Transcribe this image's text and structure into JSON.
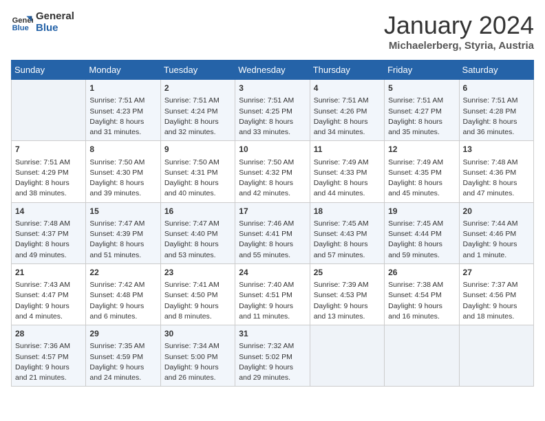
{
  "logo": {
    "line1": "General",
    "line2": "Blue"
  },
  "title": "January 2024",
  "location": "Michaelerberg, Styria, Austria",
  "weekdays": [
    "Sunday",
    "Monday",
    "Tuesday",
    "Wednesday",
    "Thursday",
    "Friday",
    "Saturday"
  ],
  "weeks": [
    [
      {
        "day": "",
        "sunrise": "",
        "sunset": "",
        "daylight": ""
      },
      {
        "day": "1",
        "sunrise": "Sunrise: 7:51 AM",
        "sunset": "Sunset: 4:23 PM",
        "daylight": "Daylight: 8 hours and 31 minutes."
      },
      {
        "day": "2",
        "sunrise": "Sunrise: 7:51 AM",
        "sunset": "Sunset: 4:24 PM",
        "daylight": "Daylight: 8 hours and 32 minutes."
      },
      {
        "day": "3",
        "sunrise": "Sunrise: 7:51 AM",
        "sunset": "Sunset: 4:25 PM",
        "daylight": "Daylight: 8 hours and 33 minutes."
      },
      {
        "day": "4",
        "sunrise": "Sunrise: 7:51 AM",
        "sunset": "Sunset: 4:26 PM",
        "daylight": "Daylight: 8 hours and 34 minutes."
      },
      {
        "day": "5",
        "sunrise": "Sunrise: 7:51 AM",
        "sunset": "Sunset: 4:27 PM",
        "daylight": "Daylight: 8 hours and 35 minutes."
      },
      {
        "day": "6",
        "sunrise": "Sunrise: 7:51 AM",
        "sunset": "Sunset: 4:28 PM",
        "daylight": "Daylight: 8 hours and 36 minutes."
      }
    ],
    [
      {
        "day": "7",
        "sunrise": "Sunrise: 7:51 AM",
        "sunset": "Sunset: 4:29 PM",
        "daylight": "Daylight: 8 hours and 38 minutes."
      },
      {
        "day": "8",
        "sunrise": "Sunrise: 7:50 AM",
        "sunset": "Sunset: 4:30 PM",
        "daylight": "Daylight: 8 hours and 39 minutes."
      },
      {
        "day": "9",
        "sunrise": "Sunrise: 7:50 AM",
        "sunset": "Sunset: 4:31 PM",
        "daylight": "Daylight: 8 hours and 40 minutes."
      },
      {
        "day": "10",
        "sunrise": "Sunrise: 7:50 AM",
        "sunset": "Sunset: 4:32 PM",
        "daylight": "Daylight: 8 hours and 42 minutes."
      },
      {
        "day": "11",
        "sunrise": "Sunrise: 7:49 AM",
        "sunset": "Sunset: 4:33 PM",
        "daylight": "Daylight: 8 hours and 44 minutes."
      },
      {
        "day": "12",
        "sunrise": "Sunrise: 7:49 AM",
        "sunset": "Sunset: 4:35 PM",
        "daylight": "Daylight: 8 hours and 45 minutes."
      },
      {
        "day": "13",
        "sunrise": "Sunrise: 7:48 AM",
        "sunset": "Sunset: 4:36 PM",
        "daylight": "Daylight: 8 hours and 47 minutes."
      }
    ],
    [
      {
        "day": "14",
        "sunrise": "Sunrise: 7:48 AM",
        "sunset": "Sunset: 4:37 PM",
        "daylight": "Daylight: 8 hours and 49 minutes."
      },
      {
        "day": "15",
        "sunrise": "Sunrise: 7:47 AM",
        "sunset": "Sunset: 4:39 PM",
        "daylight": "Daylight: 8 hours and 51 minutes."
      },
      {
        "day": "16",
        "sunrise": "Sunrise: 7:47 AM",
        "sunset": "Sunset: 4:40 PM",
        "daylight": "Daylight: 8 hours and 53 minutes."
      },
      {
        "day": "17",
        "sunrise": "Sunrise: 7:46 AM",
        "sunset": "Sunset: 4:41 PM",
        "daylight": "Daylight: 8 hours and 55 minutes."
      },
      {
        "day": "18",
        "sunrise": "Sunrise: 7:45 AM",
        "sunset": "Sunset: 4:43 PM",
        "daylight": "Daylight: 8 hours and 57 minutes."
      },
      {
        "day": "19",
        "sunrise": "Sunrise: 7:45 AM",
        "sunset": "Sunset: 4:44 PM",
        "daylight": "Daylight: 8 hours and 59 minutes."
      },
      {
        "day": "20",
        "sunrise": "Sunrise: 7:44 AM",
        "sunset": "Sunset: 4:46 PM",
        "daylight": "Daylight: 9 hours and 1 minute."
      }
    ],
    [
      {
        "day": "21",
        "sunrise": "Sunrise: 7:43 AM",
        "sunset": "Sunset: 4:47 PM",
        "daylight": "Daylight: 9 hours and 4 minutes."
      },
      {
        "day": "22",
        "sunrise": "Sunrise: 7:42 AM",
        "sunset": "Sunset: 4:48 PM",
        "daylight": "Daylight: 9 hours and 6 minutes."
      },
      {
        "day": "23",
        "sunrise": "Sunrise: 7:41 AM",
        "sunset": "Sunset: 4:50 PM",
        "daylight": "Daylight: 9 hours and 8 minutes."
      },
      {
        "day": "24",
        "sunrise": "Sunrise: 7:40 AM",
        "sunset": "Sunset: 4:51 PM",
        "daylight": "Daylight: 9 hours and 11 minutes."
      },
      {
        "day": "25",
        "sunrise": "Sunrise: 7:39 AM",
        "sunset": "Sunset: 4:53 PM",
        "daylight": "Daylight: 9 hours and 13 minutes."
      },
      {
        "day": "26",
        "sunrise": "Sunrise: 7:38 AM",
        "sunset": "Sunset: 4:54 PM",
        "daylight": "Daylight: 9 hours and 16 minutes."
      },
      {
        "day": "27",
        "sunrise": "Sunrise: 7:37 AM",
        "sunset": "Sunset: 4:56 PM",
        "daylight": "Daylight: 9 hours and 18 minutes."
      }
    ],
    [
      {
        "day": "28",
        "sunrise": "Sunrise: 7:36 AM",
        "sunset": "Sunset: 4:57 PM",
        "daylight": "Daylight: 9 hours and 21 minutes."
      },
      {
        "day": "29",
        "sunrise": "Sunrise: 7:35 AM",
        "sunset": "Sunset: 4:59 PM",
        "daylight": "Daylight: 9 hours and 24 minutes."
      },
      {
        "day": "30",
        "sunrise": "Sunrise: 7:34 AM",
        "sunset": "Sunset: 5:00 PM",
        "daylight": "Daylight: 9 hours and 26 minutes."
      },
      {
        "day": "31",
        "sunrise": "Sunrise: 7:32 AM",
        "sunset": "Sunset: 5:02 PM",
        "daylight": "Daylight: 9 hours and 29 minutes."
      },
      {
        "day": "",
        "sunrise": "",
        "sunset": "",
        "daylight": ""
      },
      {
        "day": "",
        "sunrise": "",
        "sunset": "",
        "daylight": ""
      },
      {
        "day": "",
        "sunrise": "",
        "sunset": "",
        "daylight": ""
      }
    ]
  ]
}
